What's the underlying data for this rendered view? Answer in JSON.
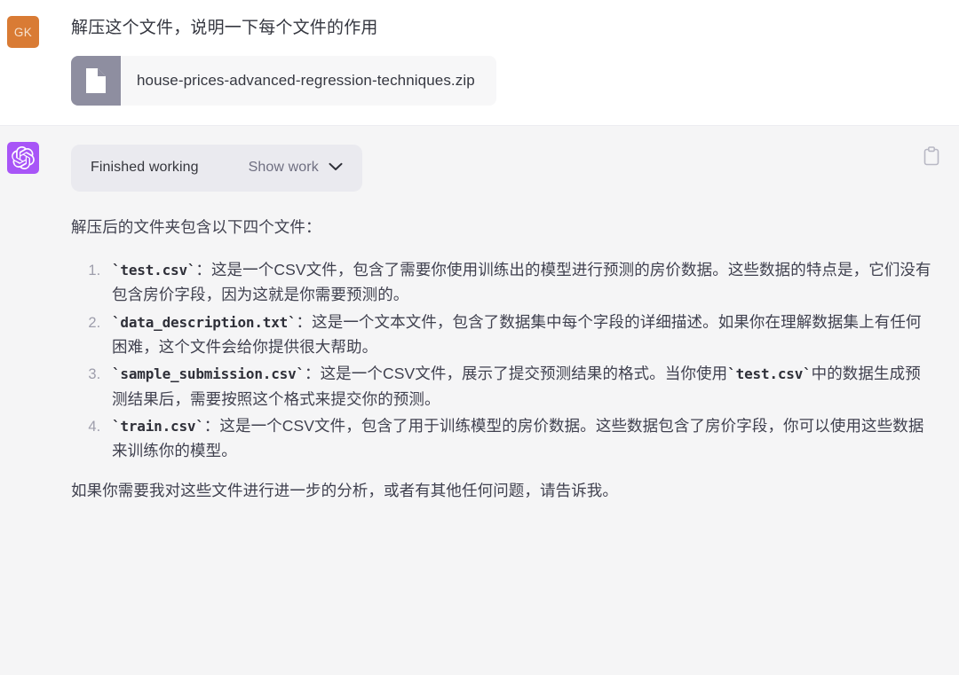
{
  "theme": {
    "user_bg": "#ffffff",
    "assistant_bg": "#f5f5f6",
    "user_avatar_bg": "#d97b34",
    "assistant_avatar_bg": "#a855f7",
    "work_bar_bg": "#eaeaef",
    "file_chip_bg": "#f7f7f8",
    "file_icon_bg": "#8e8ea0",
    "text_color": "#40414f"
  },
  "user_turn": {
    "avatar_initials": "GK",
    "avatar_icon": "user-avatar-initials",
    "message": "解压这个文件，说明一下每个文件的作用",
    "attachment": {
      "icon": "document-file-icon",
      "filename": "house-prices-advanced-regression-techniques.zip"
    }
  },
  "assistant_turn": {
    "avatar_icon": "openai-logo-icon",
    "tool_bar": {
      "status": "Finished working",
      "toggle_label": "Show work",
      "toggle_icon": "chevron-down-icon"
    },
    "copy_button": {
      "icon": "clipboard-copy-icon"
    },
    "body": {
      "intro": "解压后的文件夹包含以下四个文件：",
      "items": [
        {
          "code": "`test.csv`",
          "text": "：这是一个CSV文件，包含了需要你使用训练出的模型进行预测的房价数据。这些数据的特点是，它们没有包含房价字段，因为这就是你需要预测的。"
        },
        {
          "code": "`data_description.txt`",
          "text": "：这是一个文本文件，包含了数据集中每个字段的详细描述。如果你在理解数据集上有任何困难，这个文件会给你提供很大帮助。"
        },
        {
          "code": "`sample_submission.csv`",
          "text_before": "：这是一个CSV文件，展示了提交预测结果的格式。当你使用",
          "code_inline": "`test.csv`",
          "text_after": "中的数据生成预测结果后，需要按照这个格式来提交你的预测。"
        },
        {
          "code": "`train.csv`",
          "text": "：这是一个CSV文件，包含了用于训练模型的房价数据。这些数据包含了房价字段，你可以使用这些数据来训练你的模型。"
        }
      ],
      "outro": "如果你需要我对这些文件进行进一步的分析，或者有其他任何问题，请告诉我。"
    }
  }
}
